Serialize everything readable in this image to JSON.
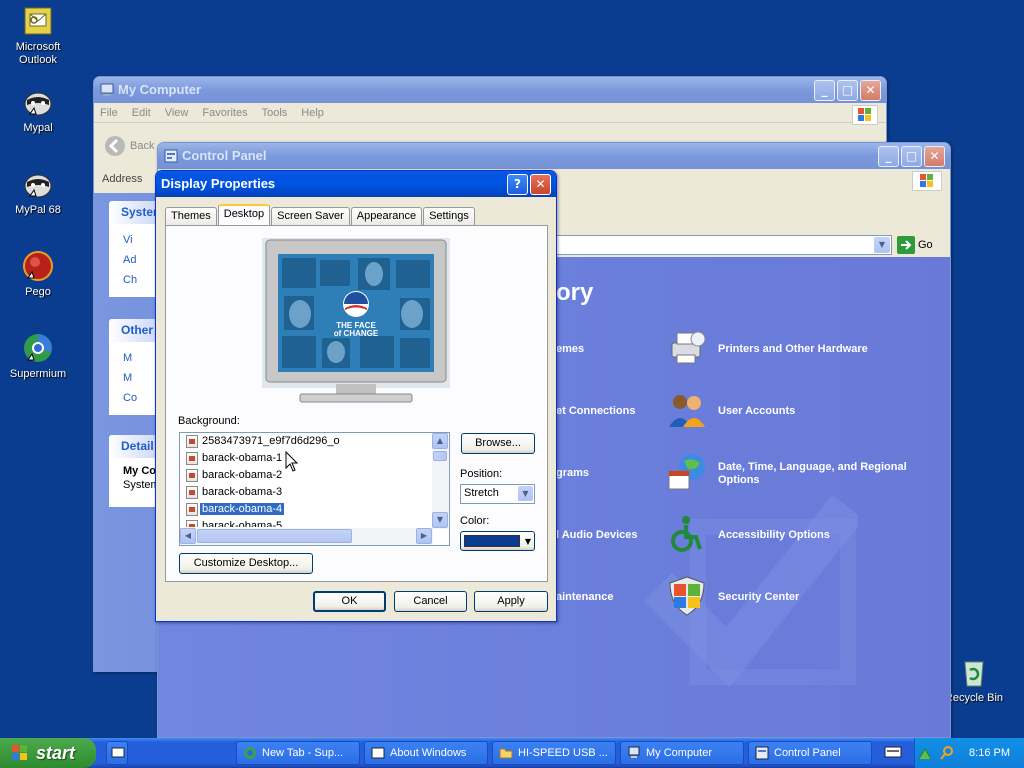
{
  "desktop": {
    "icons": [
      {
        "label": "Microsoft Outlook",
        "icon": "outlook-icon"
      },
      {
        "label": "Mypal",
        "icon": "mypal-icon"
      },
      {
        "label": "MyPal 68",
        "icon": "mypal68-icon"
      },
      {
        "label": "Pego",
        "icon": "pego-icon"
      },
      {
        "label": "Supermium",
        "icon": "supermium-icon"
      },
      {
        "label": "Recycle Bin",
        "icon": "recycle-bin-icon"
      }
    ]
  },
  "my_computer": {
    "title": "My Computer",
    "menu": [
      "File",
      "Edit",
      "View",
      "Favorites",
      "Tools",
      "Help"
    ],
    "back_label": "Back",
    "address_label": "Address",
    "panels": [
      {
        "title": "System",
        "items": [
          "Vi",
          "Ad",
          "Ch"
        ]
      },
      {
        "title": "Other",
        "items": [
          "M",
          "M",
          "Co"
        ]
      },
      {
        "title": "Detail",
        "items": [
          "My Co",
          "System"
        ]
      }
    ]
  },
  "control_panel": {
    "title": "Control Panel",
    "go_label": "Go",
    "heading_fragment": "ory",
    "left_categories": [
      "emes",
      "et Connections",
      "grams",
      "l Audio Devices",
      "aintenance"
    ],
    "right_categories": [
      {
        "label": "Printers and Other Hardware",
        "icon": "printer-icon"
      },
      {
        "label": "User Accounts",
        "icon": "user-accounts-icon"
      },
      {
        "label": "Date, Time, Language, and Regional Options",
        "icon": "date-time-icon"
      },
      {
        "label": "Accessibility Options",
        "icon": "accessibility-icon"
      },
      {
        "label": "Security Center",
        "icon": "security-shield-icon"
      }
    ]
  },
  "dialog": {
    "title": "Display Properties",
    "tabs": [
      "Themes",
      "Desktop",
      "Screen Saver",
      "Appearance",
      "Settings"
    ],
    "active_tab": "Desktop",
    "preview_text": {
      "line1": "THE FACE",
      "line2": "of CHANGE"
    },
    "background_label": "Background:",
    "background_items": [
      "2583473971_e9f7d6d296_o",
      "barack-obama-1",
      "barack-obama-2",
      "barack-obama-3",
      "barack-obama-4",
      "barack-obama-5"
    ],
    "selected_item": "barack-obama-4",
    "browse_label": "Browse...",
    "position_label": "Position:",
    "position_value": "Stretch",
    "color_label": "Color:",
    "color_value": "#0a3d8f",
    "customize_label": "Customize Desktop...",
    "ok_label": "OK",
    "cancel_label": "Cancel",
    "apply_label": "Apply"
  },
  "taskbar": {
    "start_label": "start",
    "items": [
      "New Tab - Sup...",
      "About Windows",
      "HI-SPEED USB ...",
      "My Computer",
      "Control Panel"
    ],
    "clock": "8:16 PM"
  }
}
